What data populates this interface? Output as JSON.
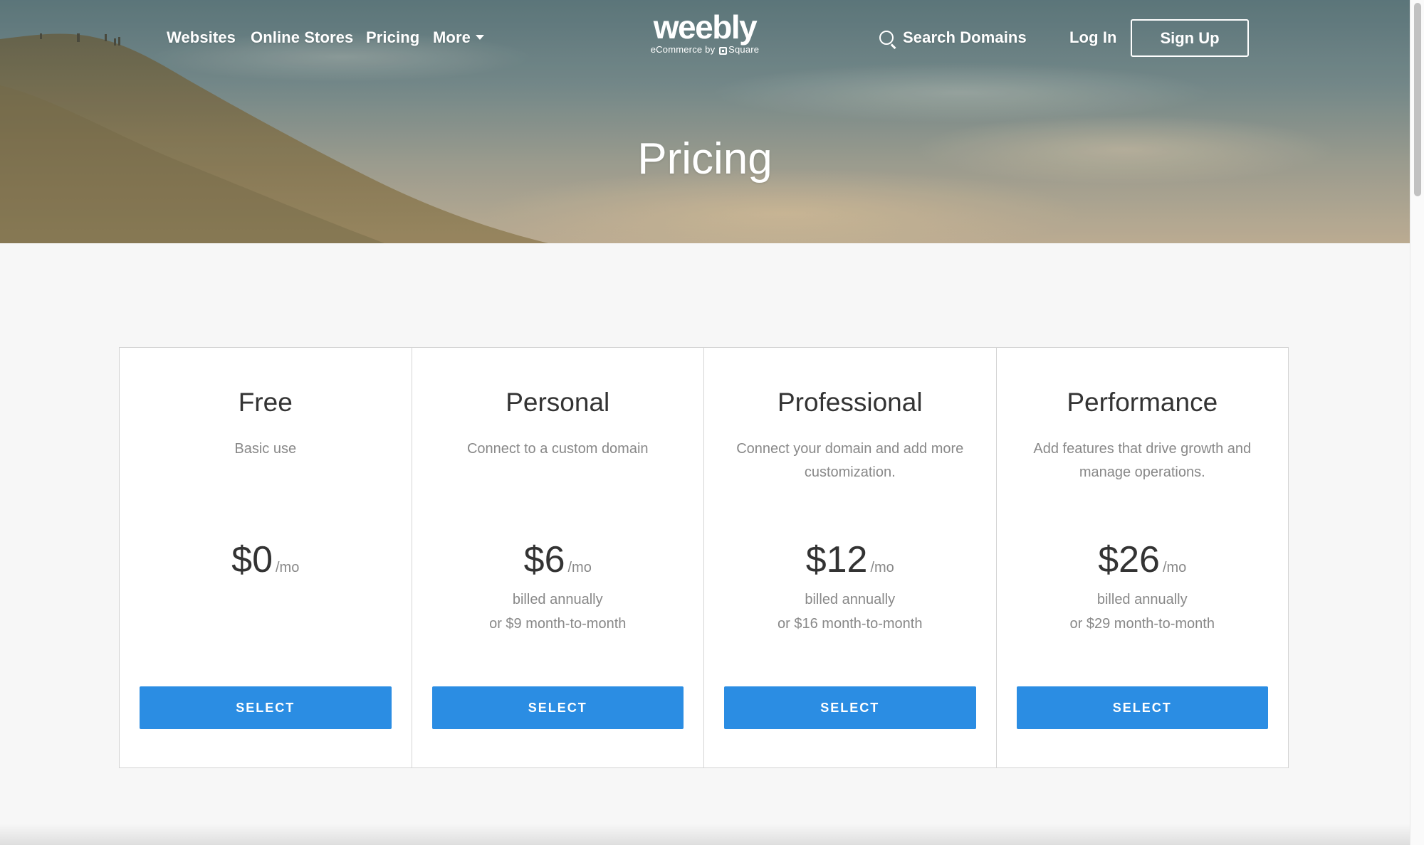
{
  "nav": {
    "links": [
      "Websites",
      "Online Stores",
      "Pricing",
      "More"
    ],
    "logo": "weebly",
    "logo_sub_prefix": "eCommerce by",
    "logo_sub_brand": "Square",
    "search_label": "Search Domains",
    "login_label": "Log In",
    "signup_label": "Sign Up"
  },
  "hero": {
    "title": "Pricing"
  },
  "plans": [
    {
      "name": "Free",
      "desc": "Basic use",
      "price": "$0",
      "per": "/mo",
      "billing": "",
      "alt": "",
      "button": "SELECT"
    },
    {
      "name": "Personal",
      "desc": "Connect to a custom domain",
      "price": "$6",
      "per": "/mo",
      "billing": "billed annually",
      "alt": "or $9 month-to-month",
      "button": "SELECT"
    },
    {
      "name": "Professional",
      "desc": "Connect your domain and add more customization.",
      "price": "$12",
      "per": "/mo",
      "billing": "billed annually",
      "alt": "or $16 month-to-month",
      "button": "SELECT"
    },
    {
      "name": "Performance",
      "desc": "Add features that drive growth and manage operations.",
      "price": "$26",
      "per": "/mo",
      "billing": "billed annually",
      "alt": "or $29 month-to-month",
      "button": "SELECT"
    }
  ],
  "colors": {
    "accent": "#2b8de3",
    "border": "#d4d4d4",
    "text": "#333333",
    "muted": "#888888"
  }
}
